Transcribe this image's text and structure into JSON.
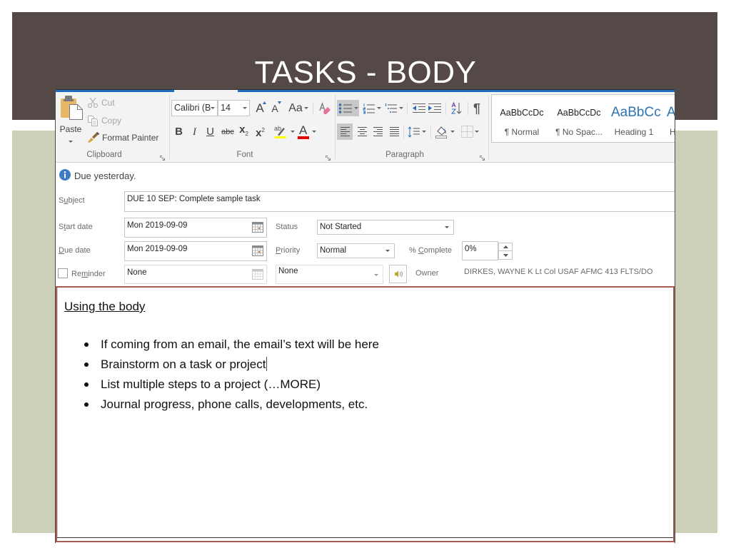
{
  "slide": {
    "title": "TASKS - BODY"
  },
  "theme": {
    "header_bg": "#544946",
    "content_bg": "#cdd0b8",
    "ribbon_accent": "#1f6fc0",
    "body_border": "#a65b53",
    "heading_style_color": "#2e74b5",
    "info_icon_color": "#3e7bc4",
    "highlight_color": "#ffff00",
    "font_color": "#e00000"
  },
  "ribbon": {
    "clipboard": {
      "group_label": "Clipboard",
      "paste": "Paste",
      "cut": "Cut",
      "copy": "Copy",
      "format_painter": "Format Painter"
    },
    "font": {
      "group_label": "Font",
      "font_name": "Calibri (B",
      "font_size": "14",
      "grow_font_glyph": "A",
      "shrink_font_glyph": "A",
      "change_case_glyph": "Aa",
      "bold_glyph": "B",
      "italic_glyph": "I",
      "underline_glyph": "U",
      "strikethrough_glyph": "abc",
      "subscript_glyph": "x",
      "subscript_mark": "2",
      "superscript_glyph": "x",
      "superscript_mark": "2",
      "highlight_glyph": "ab",
      "font_color_glyph": "A"
    },
    "paragraph": {
      "group_label": "Paragraph",
      "pilcrow_glyph": "¶"
    },
    "styles": [
      {
        "preview": "AaBbCcDc",
        "name": "¶ Normal"
      },
      {
        "preview": "AaBbCcDc",
        "name": "¶ No Spac..."
      },
      {
        "preview": "AaBbCc",
        "name": "Heading 1"
      },
      {
        "preview": "A",
        "name": "H"
      }
    ]
  },
  "infobar": {
    "message": "Due yesterday."
  },
  "form": {
    "subject": {
      "label": {
        "pre": "S",
        "key": "u",
        "post": "bject"
      },
      "value": "DUE 10 SEP: Complete sample task"
    },
    "start_date": {
      "label": {
        "pre": "S",
        "key": "t",
        "post": "art date"
      },
      "value": "Mon 2019-09-09"
    },
    "due_date": {
      "label": {
        "pre": "",
        "key": "D",
        "post": "ue date"
      },
      "value": "Mon 2019-09-09"
    },
    "status": {
      "label": "Status",
      "value": "Not Started"
    },
    "priority": {
      "label": {
        "pre": "",
        "key": "P",
        "post": "riority"
      },
      "value": "Normal"
    },
    "percent_complete": {
      "label": {
        "pre": "% ",
        "key": "C",
        "post": "omplete"
      },
      "value": "0%"
    },
    "reminder": {
      "label": {
        "pre": "Re",
        "key": "m",
        "post": "inder"
      },
      "checked": false,
      "date": "None",
      "time": "None"
    },
    "owner": {
      "label": "Owner",
      "value": "DIRKES, WAYNE K Lt Col USAF AFMC 413 FLTS/DO"
    }
  },
  "body": {
    "heading": "Using the body",
    "bullets": [
      "If coming from an email, the email’s text will be here",
      "Brainstorm on a task or project",
      "List multiple steps to a project (…MORE)",
      "Journal progress, phone calls, developments, etc."
    ]
  }
}
